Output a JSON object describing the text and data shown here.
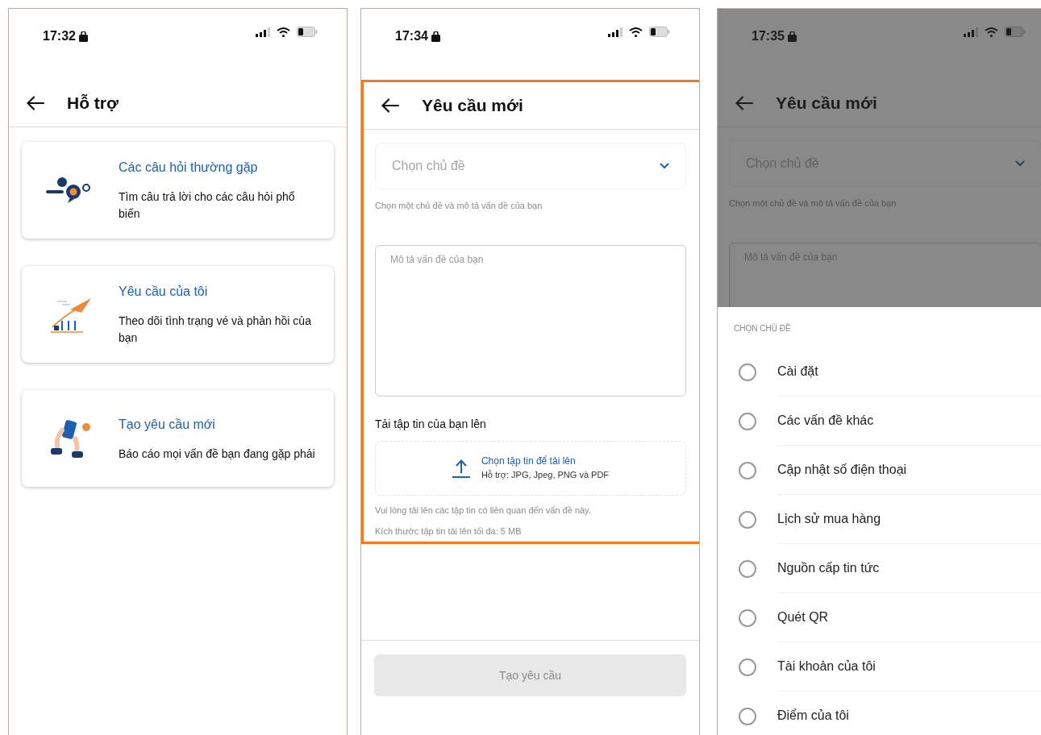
{
  "screens": [
    {
      "kind": "support",
      "status_time": "17:32",
      "title": "Hỗ trợ",
      "cards": [
        {
          "title": "Các câu hỏi thường gặp",
          "description": "Tìm câu trả lời cho các câu hỏi phổ biến"
        },
        {
          "title": "Yêu cầu của tôi",
          "description": "Theo dõi tình trạng vé và phản hồi của bạn"
        },
        {
          "title": "Tạo yêu cầu mới",
          "description": "Báo cáo mọi vấn đề bạn đang gặp phải"
        }
      ]
    },
    {
      "kind": "new_request",
      "status_time": "17:34",
      "title": "Yêu cầu mới",
      "highlighted": true,
      "topic_placeholder": "Chọn chủ đề",
      "topic_hint": "Chọn một chủ đề và mô tả vấn đề của bạn",
      "description_placeholder": "Mô tả vấn đề của bạn",
      "upload_label": "Tải tập tin của bạn lên",
      "upload_link": "Chọn tập tin để tải lên",
      "upload_formats": "Hỗ trợ: JPG, Jpeg, PNG và PDF",
      "notes": [
        "Vui lòng tải lên các tập tin có liên quan đến vấn đề này.",
        "Kích thước tập tin tải lên tối đa: 5 MB"
      ],
      "submit_label": "Tạo yêu cầu",
      "submit_disabled": true
    },
    {
      "kind": "topic_sheet",
      "status_time": "17:35",
      "title": "Yêu cầu mới",
      "topic_placeholder": "Chọn chủ đề",
      "topic_hint": "Chọn một chủ đề và mô tả vấn đề của bạn",
      "description_placeholder": "Mô tả vấn đề của bạn",
      "sheet_heading": "CHỌN CHỦ ĐỀ",
      "options": [
        {
          "label": "Cài đặt",
          "selected": false
        },
        {
          "label": "Các vấn đề khác",
          "selected": false
        },
        {
          "label": "Cập nhật số điện thoại",
          "selected": false
        },
        {
          "label": "Lịch sử mua hàng",
          "selected": false
        },
        {
          "label": "Nguồn cấp tin tức",
          "selected": false
        },
        {
          "label": "Quét QR",
          "selected": false
        },
        {
          "label": "Tài khoản của tôi",
          "selected": false
        },
        {
          "label": "Điểm của tôi",
          "selected": false
        }
      ]
    }
  ]
}
